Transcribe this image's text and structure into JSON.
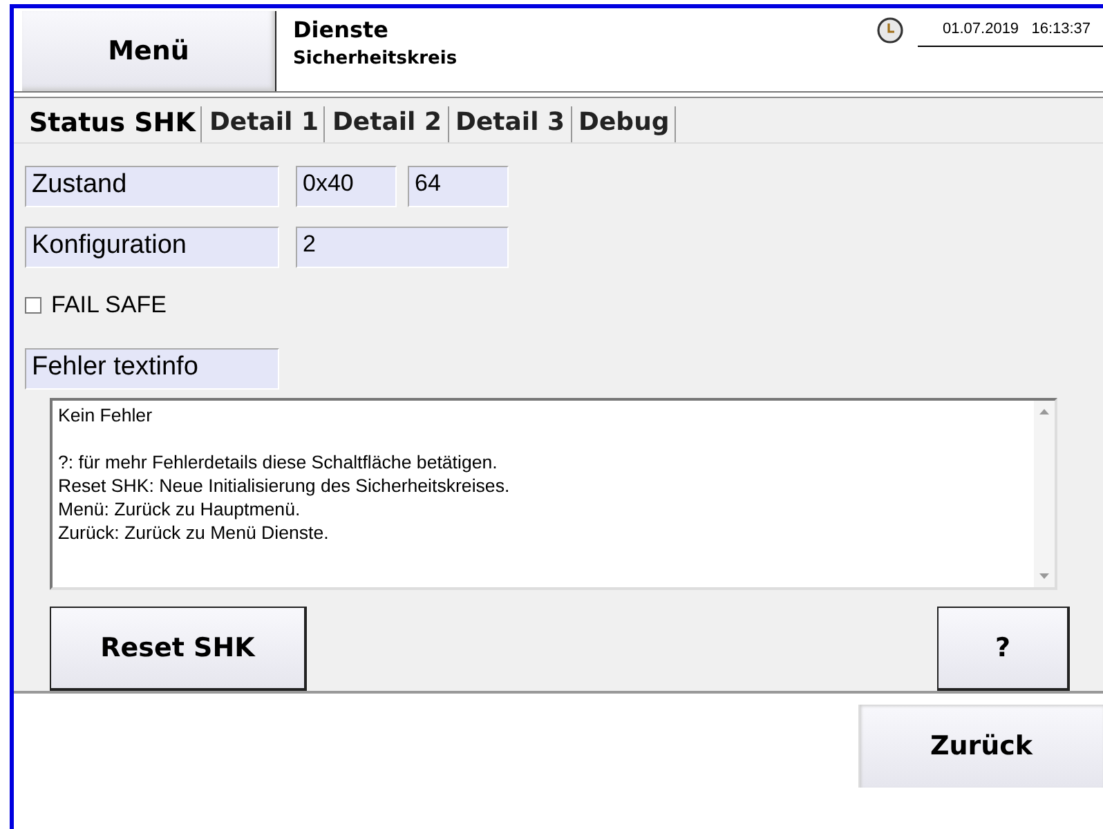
{
  "header": {
    "menu_button": "Menü",
    "title": "Dienste",
    "subtitle": "Sicherheitskreis",
    "datetime": "01.07.2019   16:13:37"
  },
  "tabs": [
    {
      "label": "Status SHK",
      "selected": true
    },
    {
      "label": "Detail 1",
      "selected": false
    },
    {
      "label": "Detail 2",
      "selected": false
    },
    {
      "label": "Detail 3",
      "selected": false
    },
    {
      "label": "Debug",
      "selected": false
    }
  ],
  "zustand": {
    "label": "Zustand",
    "hex": "0x40",
    "decimal": "64"
  },
  "konfiguration": {
    "label": "Konfiguration",
    "value": "2"
  },
  "fail_safe": {
    "label": "FAIL SAFE",
    "checked": false
  },
  "fehler": {
    "label": "Fehler textinfo",
    "text": "Kein Fehler\n\n?: für mehr Fehlerdetails diese Schaltfläche betätigen.\nReset SHK: Neue Initialisierung des Sicherheitskreises.\nMenü: Zurück zu Hauptmenü.\nZurück: Zurück zu Menü Dienste."
  },
  "buttons": {
    "reset": "Reset SHK",
    "help": "?",
    "back": "Zurück"
  }
}
